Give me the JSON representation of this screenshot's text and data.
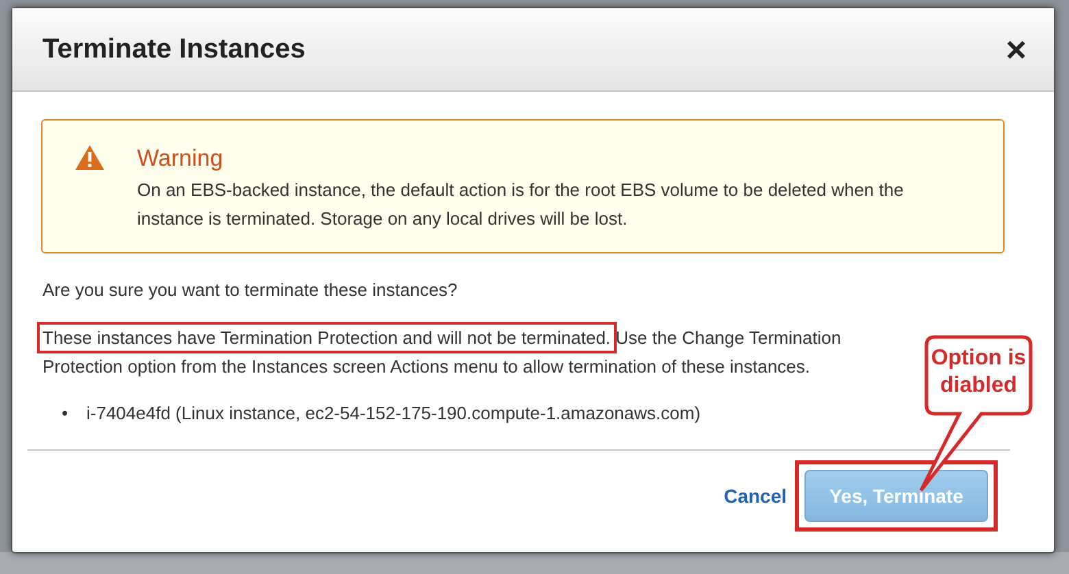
{
  "dialog": {
    "title": "Terminate Instances",
    "close": "×",
    "warning": {
      "title": "Warning",
      "text": "On an EBS-backed instance, the default action is for the root EBS volume to be deleted when the instance is terminated. Storage on any local drives will be lost."
    },
    "question": "Are you sure you want to terminate these instances?",
    "protection_note": {
      "highlighted": "These instances have Termination Protection and will not be terminated.",
      "rest": "Use the Change Termination Protection option from the Instances screen Actions menu to allow termination of these instances."
    },
    "instances": [
      {
        "bullet": "•",
        "text": "i-7404e4fd (Linux instance, ec2-54-152-175-190.compute-1.amazonaws.com)"
      }
    ],
    "buttons": [
      {
        "kind": "link",
        "label": "Cancel"
      },
      {
        "kind": "primary",
        "label": "Yes, Terminate",
        "disabled": true,
        "highlighted": true
      }
    ]
  },
  "callout": {
    "text": "Option is diabled"
  }
}
